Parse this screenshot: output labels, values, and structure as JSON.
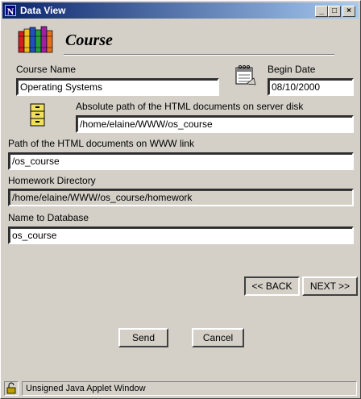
{
  "window": {
    "title": "Data View",
    "app_icon_letter": "N",
    "minimize_glyph": "_",
    "maximize_glyph": "□",
    "close_glyph": "×"
  },
  "header": {
    "title": "Course"
  },
  "form": {
    "course_name": {
      "label": "Course Name",
      "value": "Operating Systems"
    },
    "begin_date": {
      "label": "Begin Date",
      "value": "08/10/2000"
    },
    "abs_path": {
      "label": "Absolute path of the HTML documents on server disk",
      "value": "/home/elaine/WWW/os_course"
    },
    "www_path": {
      "label": "Path of the HTML documents on WWW link",
      "value": "/os_course"
    },
    "homework_dir": {
      "label": "Homework Directory",
      "value": "/home/elaine/WWW/os_course/homework"
    },
    "db_name": {
      "label": "Name to Database",
      "value": "os_course"
    }
  },
  "nav": {
    "back_label": "<< BACK",
    "next_label": "NEXT >>"
  },
  "actions": {
    "send_label": "Send",
    "cancel_label": "Cancel"
  },
  "status": {
    "text": "Unsigned Java Applet Window"
  },
  "colors": {
    "window_bg": "#d4d0c8",
    "titlebar_start": "#0a246a",
    "titlebar_end": "#a6caf0"
  },
  "icons": {
    "app": "netscape-icon",
    "logo": "books-icon",
    "calendar": "calendar-icon",
    "cabinet": "file-cabinet-icon",
    "lock": "lock-icon"
  }
}
